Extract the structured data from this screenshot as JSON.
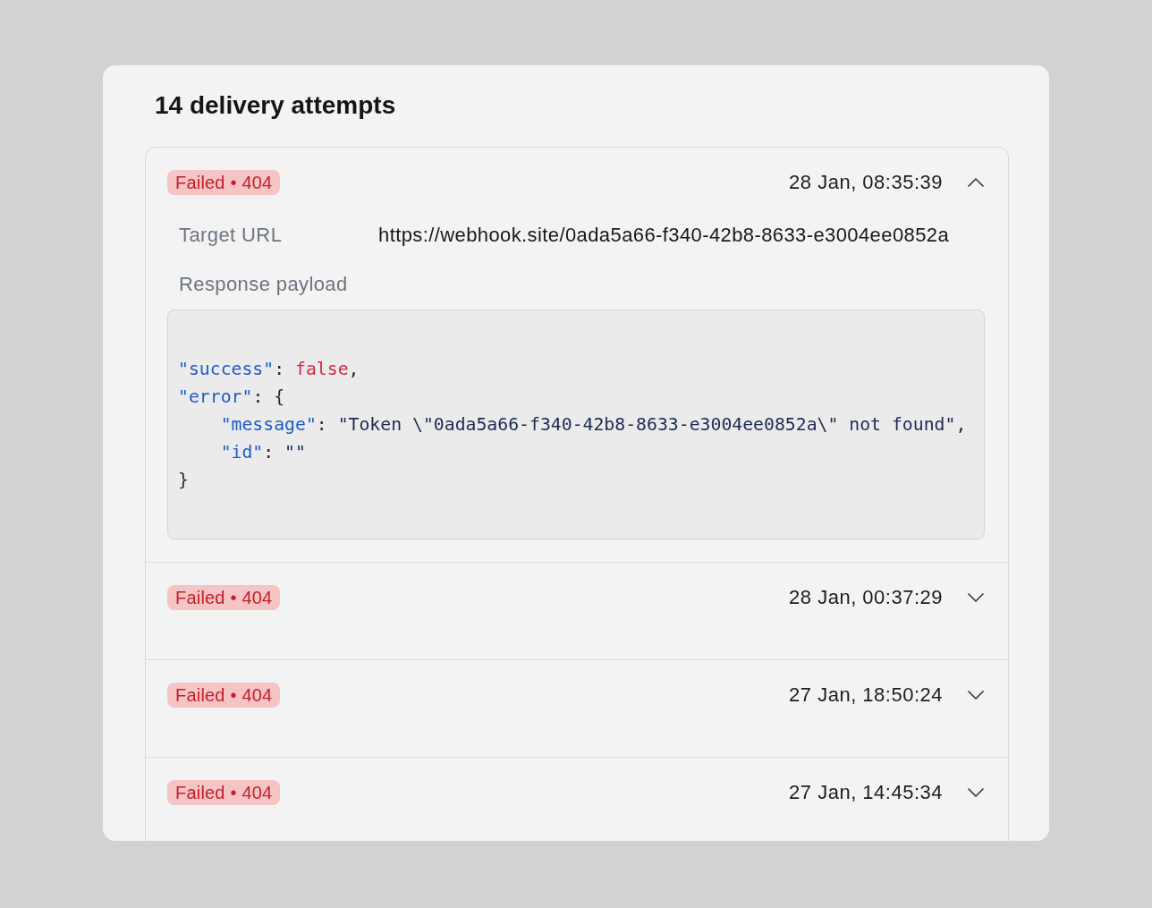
{
  "title": "14 delivery attempts",
  "attempts": [
    {
      "status": "Failed • 404",
      "time": "28 Jan, 08:35:39",
      "expanded": true,
      "details": {
        "target_url_label": "Target URL",
        "target_url": "https://webhook.site/0ada5a66-f340-42b8-8633-e3004ee0852a",
        "payload_label": "Response payload",
        "payload": [
          {
            "tokens": [
              {
                "kind": "key",
                "text": "\"success\""
              },
              {
                "kind": "punct",
                "text": ": "
              },
              {
                "kind": "bool",
                "text": "false"
              },
              {
                "kind": "punct",
                "text": ","
              }
            ]
          },
          {
            "tokens": [
              {
                "kind": "key",
                "text": "\"error\""
              },
              {
                "kind": "punct",
                "text": ": {"
              }
            ],
            "children": [
              {
                "tokens": [
                  {
                    "kind": "key",
                    "text": "\"message\""
                  },
                  {
                    "kind": "punct",
                    "text": ": "
                  },
                  {
                    "kind": "string",
                    "text": "\"Token \\\"0ada5a66-f340-42b8-8633-e3004ee0852a\\\" not found\""
                  },
                  {
                    "kind": "punct",
                    "text": ","
                  }
                ]
              },
              {
                "tokens": [
                  {
                    "kind": "key",
                    "text": "\"id\""
                  },
                  {
                    "kind": "punct",
                    "text": ": "
                  },
                  {
                    "kind": "string",
                    "text": "\"\""
                  }
                ]
              }
            ]
          },
          {
            "tokens": [
              {
                "kind": "punct",
                "text": "}"
              }
            ]
          }
        ]
      }
    },
    {
      "status": "Failed • 404",
      "time": "28 Jan, 00:37:29",
      "expanded": false
    },
    {
      "status": "Failed • 404",
      "time": "27 Jan, 18:50:24",
      "expanded": false
    },
    {
      "status": "Failed • 404",
      "time": "27 Jan, 14:45:34",
      "expanded": false
    }
  ]
}
